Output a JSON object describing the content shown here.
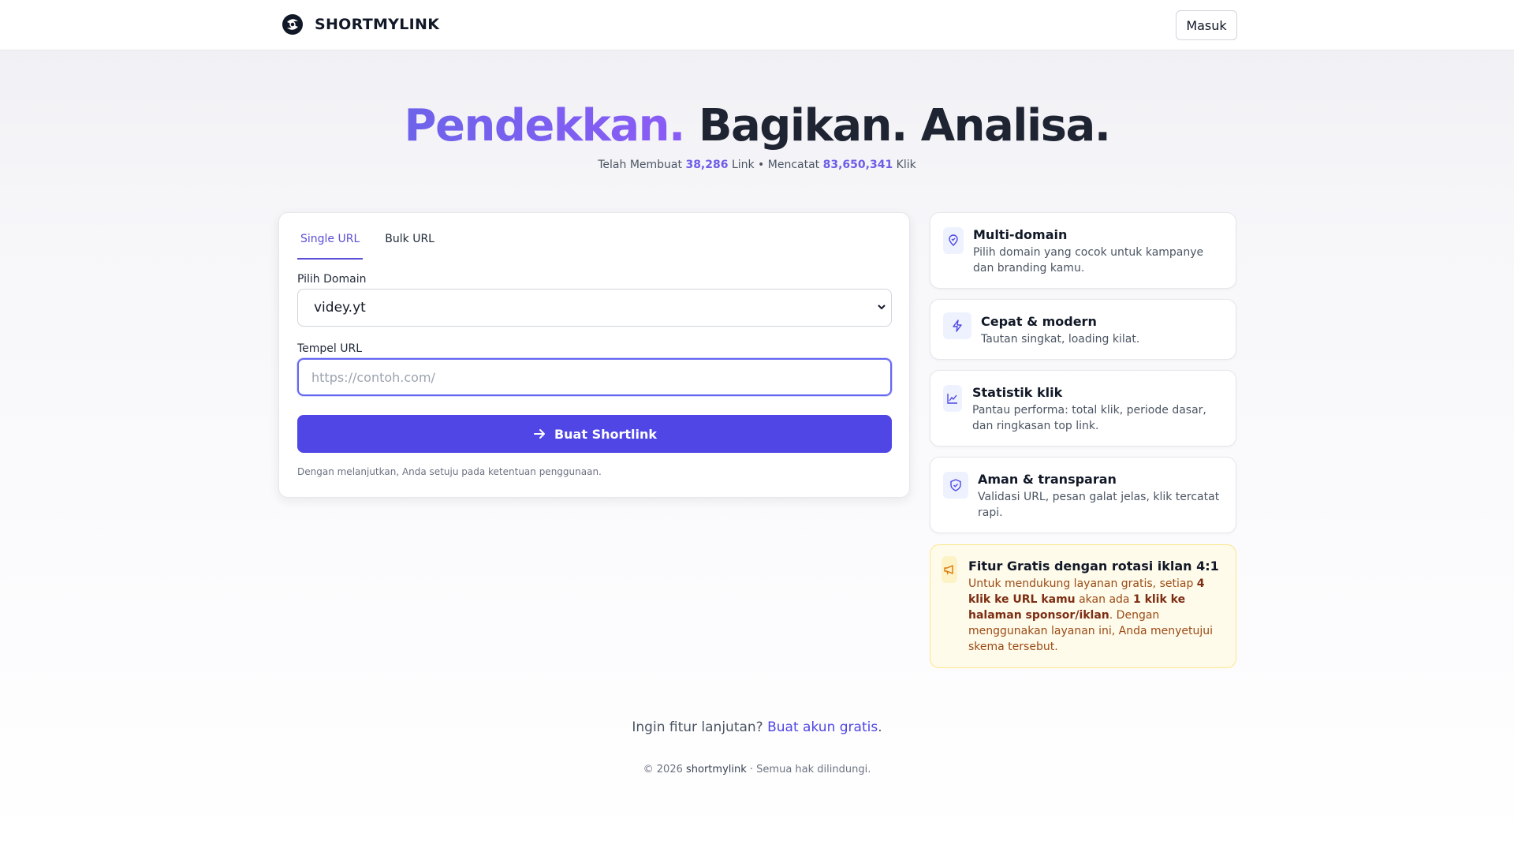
{
  "header": {
    "brand": "SHORTMYLINK",
    "login_label": "Masuk"
  },
  "hero": {
    "title_highlight": "Pendekkan.",
    "title_rest": "Bagikan. Analisa.",
    "stats_prefix": "Telah Membuat",
    "links_count": "38,286",
    "links_suffix": "Link • Mencatat",
    "clicks_count": "83,650,341",
    "clicks_suffix": "Klik"
  },
  "form": {
    "tabs": [
      {
        "label": "Single URL",
        "active": true
      },
      {
        "label": "Bulk URL",
        "active": false
      }
    ],
    "domain_label": "Pilih Domain",
    "domain_value": "videy.yt",
    "url_label": "Tempel URL",
    "url_placeholder": "https://contoh.com/",
    "url_value": "",
    "submit_label": "Buat Shortlink",
    "terms": "Dengan melanjutkan, Anda setuju pada ketentuan penggunaan."
  },
  "features": [
    {
      "icon": "location-pin-icon",
      "title": "Multi-domain",
      "desc": "Pilih domain yang cocok untuk kampanye dan branding kamu."
    },
    {
      "icon": "lightning-icon",
      "title": "Cepat & modern",
      "desc": "Tautan singkat, loading kilat."
    },
    {
      "icon": "chart-line-icon",
      "title": "Statistik klik",
      "desc": "Pantau performa: total klik, periode dasar, dan ringkasan top link."
    },
    {
      "icon": "shield-check-icon",
      "title": "Aman & transparan",
      "desc": "Validasi URL, pesan galat jelas, klik tercatat rapi."
    }
  ],
  "promo": {
    "icon": "megaphone-icon",
    "title": "Fitur Gratis dengan rotasi iklan 4:1",
    "p1": "Untuk mendukung layanan gratis, setiap ",
    "b1": "4 klik ke URL kamu",
    "p2": " akan ada ",
    "b2": "1 klik ke halaman sponsor/iklan",
    "p3": ". Dengan menggunakan layanan ini, Anda menyetujui skema tersebut."
  },
  "footer": {
    "cta_text": "Ingin fitur lanjutan?",
    "cta_link": "Buat akun gratis",
    "cta_end": ".",
    "copyright": "© 2026",
    "owner": "shortmylink",
    "rights": "· Semua hak dilindungi."
  },
  "colors": {
    "accent": "#4f46e5",
    "gradient_start": "#6d63ea",
    "gradient_end": "#8b5cf6",
    "promo_bg": "#fffbeb"
  }
}
